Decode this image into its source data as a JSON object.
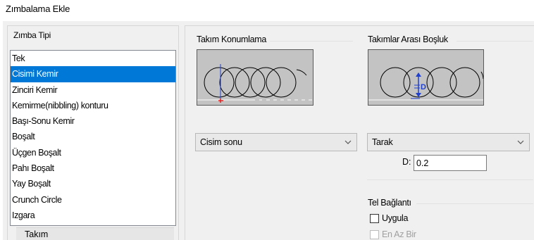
{
  "window": {
    "title": "Zımbalama Ekle"
  },
  "punch_type": {
    "header": "Zımba Tipi",
    "items": [
      "Tek",
      "Cisimi Kemir",
      "Zinciri Kemir",
      "Kemirme(nibbling) konturu",
      "Başı-Sonu Kemir",
      "Boşalt",
      "Üçgen Boşalt",
      "Pahı Boşalt",
      "Yay Boşalt",
      "Crunch Circle",
      "Izgara"
    ],
    "selected_index": 1,
    "tab_label": "Takım"
  },
  "tool_position": {
    "header": "Takım Konumlama",
    "combo_value": "Cisim sonu"
  },
  "tool_spacing": {
    "header": "Takımlar Arası Boşluk",
    "combo_value": "Tarak",
    "d_label": "D:",
    "d_value": "0.2",
    "diagram_letter": "D"
  },
  "wire_connection": {
    "header": "Tel Bağlantı",
    "apply_label": "Uygula",
    "apply_checked": false,
    "minimum_label": "En Az Bir",
    "minimum_enabled": false
  },
  "colors": {
    "selection": "#0078d7",
    "preview_bg": "#c3c3c3",
    "diagram_marker_blue": "#2040d0",
    "diagram_marker_red": "#e02020"
  },
  "icons": {
    "combo_arrow": "chevron-down-icon"
  }
}
